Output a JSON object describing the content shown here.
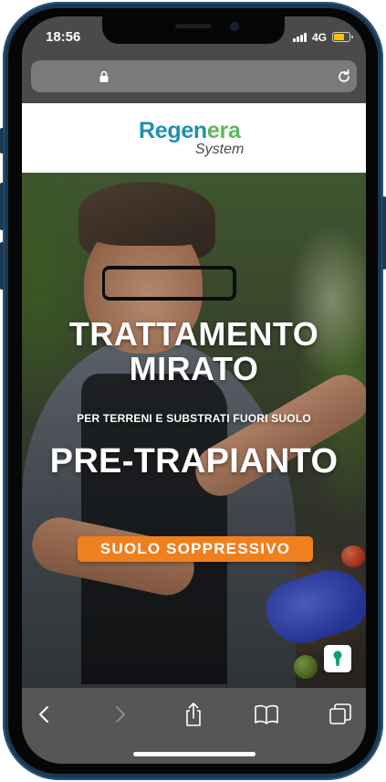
{
  "status_bar": {
    "time": "18:56",
    "network": "4G",
    "battery_icon": "battery-icon",
    "signal_icon": "signal-icon"
  },
  "browser": {
    "lock_icon": "lock-icon",
    "reload_icon": "reload-icon",
    "toolbar": {
      "back_icon": "back-icon",
      "forward_icon": "forward-icon",
      "share_icon": "share-icon",
      "bookmarks_icon": "bookmarks-icon",
      "tabs_icon": "tabs-icon"
    }
  },
  "site": {
    "logo": {
      "part1": "Regen",
      "part2": "era",
      "sub": "System"
    },
    "hero": {
      "title": "TRATTAMENTO MIRATO",
      "subtitle": "PER TERRENI E SUBSTRATI FUORI SUOLO",
      "headline": "PRE-TRAPIANTO",
      "badge": "SUOLO SOPPRESSIVO"
    },
    "chat_icon": "keyhole-icon"
  },
  "colors": {
    "logo_blue": "#1f90ae",
    "logo_green": "#5db85c",
    "badge_orange": "#f07f1e",
    "frame": "#1b3852"
  }
}
